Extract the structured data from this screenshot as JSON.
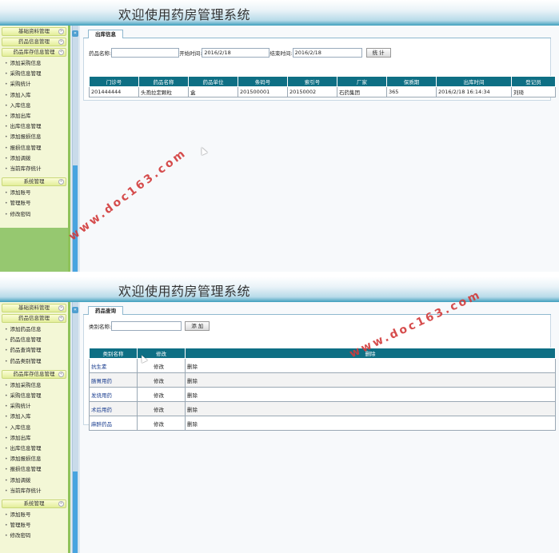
{
  "app": {
    "title": "欢迎使用药房管理系统"
  },
  "screen1": {
    "sidebar": {
      "groups": [
        {
          "label": "基础资料管理",
          "items": []
        },
        {
          "label": "药品信息管理",
          "items": []
        },
        {
          "label": "药品库存信息管理",
          "items": [
            "添加采购信息",
            "采购信息管理",
            "采购统计",
            "添加入库",
            "入库信息",
            "添加出库",
            "出库信息管理",
            "添加报损信息",
            "报损信息管理",
            "添加调拨",
            "当前库存统计"
          ]
        },
        {
          "label": "系统管理",
          "items": [
            "添加账号",
            "管理账号",
            "修改密码"
          ]
        }
      ]
    },
    "tab": "出库信息",
    "search": {
      "name_label": "药品名称:",
      "name_value": "",
      "start_label": "开始时间:",
      "start_value": "2016/2/18",
      "end_label": "结束时间:",
      "end_value": "2016/2/18",
      "button": "统 计"
    },
    "table": {
      "columns": [
        "门诊号",
        "药品名称",
        "药品单位",
        "条码号",
        "索引号",
        "厂家",
        "保质期",
        "出库时间",
        "登记员"
      ],
      "rows": [
        [
          "201444444",
          "头孢拉定颗粒",
          "盒",
          "201500001",
          "20150002",
          "石药集团",
          "365",
          "2016/2/18 16:14:34",
          "刘琦"
        ]
      ]
    }
  },
  "screen2": {
    "sidebar": {
      "groups": [
        {
          "label": "基础资料管理",
          "items": []
        },
        {
          "label": "药品信息管理",
          "items": [
            "添加药品信息",
            "药品信息管理",
            "药品查询管理",
            "药品类别管理"
          ]
        },
        {
          "label": "药品库存信息管理",
          "items": [
            "添加采购信息",
            "采购信息管理",
            "采购统计",
            "添加入库",
            "入库信息",
            "添加出库",
            "出库信息管理",
            "添加报损信息",
            "报损信息管理",
            "添加调拨",
            "当前库存统计"
          ]
        },
        {
          "label": "系统管理",
          "items": [
            "添加账号",
            "管理账号",
            "修改密码"
          ]
        }
      ]
    },
    "tab": "药品查询",
    "search": {
      "category_label": "类别名称:",
      "category_value": "",
      "button": "添 加"
    },
    "table": {
      "columns": [
        "类别名称",
        "修改",
        "删除"
      ],
      "rows": [
        [
          "抗生素",
          "修改",
          "删除"
        ],
        [
          "肠胃用药",
          "修改",
          "删除"
        ],
        [
          "发烧用药",
          "修改",
          "删除"
        ],
        [
          "术后用药",
          "修改",
          "删除"
        ],
        [
          "麻醉药品",
          "修改",
          "删除"
        ]
      ]
    }
  },
  "watermark": "www.doc163.com",
  "colors": {
    "header_bg": "#0e6f84",
    "sidebar_bg": "#f3f7d6",
    "sidebar_green": "#96c870",
    "watermark": "#d23a3a",
    "link": "#1a3d8f"
  }
}
